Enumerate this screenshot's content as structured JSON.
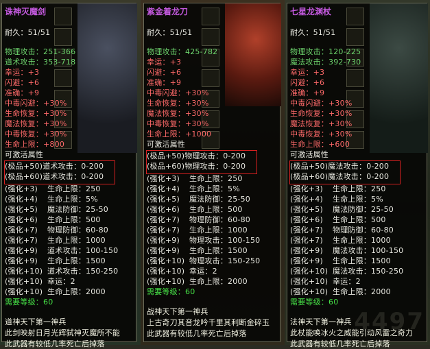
{
  "panels": [
    {
      "title": "诛神灭魔剑",
      "durability": {
        "label": "耐久：",
        "value": "51/51"
      },
      "base_stats": [
        {
          "label": "物理攻击：",
          "value": "251-366",
          "color": "green"
        },
        {
          "label": "道术攻击：",
          "value": "353-718",
          "color": "green"
        },
        {
          "label": "幸运：",
          "value": "+3",
          "color": "pink"
        },
        {
          "label": "闪避：",
          "value": "+6",
          "color": "pink"
        },
        {
          "label": "准确：",
          "value": "+9",
          "color": "pink"
        },
        {
          "label": "中毒闪避：",
          "value": "+30%",
          "color": "pink"
        },
        {
          "label": "生命恢复：",
          "value": "+30%",
          "color": "pink"
        },
        {
          "label": "魔法恢复：",
          "value": "+30%",
          "color": "pink"
        },
        {
          "label": "中毒恢复：",
          "value": "+30%",
          "color": "pink"
        },
        {
          "label": "生命上限：",
          "value": "+800",
          "color": "pink"
        }
      ],
      "activatable_label": "可激活属性",
      "highlighted": [
        {
          "tag": "(极品+50)",
          "label": "道术攻击：",
          "value": "0-200"
        },
        {
          "tag": "(极品+60)",
          "label": "道术攻击：",
          "value": "0-200"
        }
      ],
      "enhancements": [
        {
          "tag": "(强化+3)",
          "label": "生命上限：",
          "value": "250"
        },
        {
          "tag": "(强化+4)",
          "label": "生命上限：",
          "value": "5%"
        },
        {
          "tag": "(强化+5)",
          "label": "魔法防御：",
          "value": "25-50"
        },
        {
          "tag": "(强化+6)",
          "label": "生命上限：",
          "value": "500"
        },
        {
          "tag": "(强化+7)",
          "label": "物理防御：",
          "value": "60-80"
        },
        {
          "tag": "(强化+7)",
          "label": "生命上限：",
          "value": "1000"
        },
        {
          "tag": "(强化+9)",
          "label": "道术攻击：",
          "value": "100-150"
        },
        {
          "tag": "(强化+9)",
          "label": "生命上限：",
          "value": "1500"
        },
        {
          "tag": "(强化+10)",
          "label": "道术攻击：",
          "value": "150-250"
        },
        {
          "tag": "(强化+10)",
          "label": "幸运：",
          "value": "2"
        },
        {
          "tag": "(强化+10)",
          "label": "生命上限：",
          "value": "2000"
        }
      ],
      "requirement": {
        "label": "需要等级：",
        "value": "60"
      },
      "flavor": [
        "道神天下第一神兵",
        "此剑映射日月光辉弑神灭魔所不能",
        "此武器有较低几率死亡后掉落"
      ]
    },
    {
      "title": "紫金着龙刀",
      "durability": {
        "label": "耐久：",
        "value": "51/51"
      },
      "base_stats": [
        {
          "label": "物理攻击：",
          "value": "425-782",
          "color": "green"
        },
        {
          "label": "幸运：",
          "value": "+3",
          "color": "pink"
        },
        {
          "label": "闪避：",
          "value": "+6",
          "color": "pink"
        },
        {
          "label": "准确：",
          "value": "+9",
          "color": "pink"
        },
        {
          "label": "中毒闪避：",
          "value": "+30%",
          "color": "pink"
        },
        {
          "label": "生命恢复：",
          "value": "+30%",
          "color": "pink"
        },
        {
          "label": "魔法恢复：",
          "value": "+30%",
          "color": "pink"
        },
        {
          "label": "中毒恢复：",
          "value": "+30%",
          "color": "pink"
        },
        {
          "label": "生命上限：",
          "value": "+1000",
          "color": "pink"
        }
      ],
      "activatable_label": "可激活属性",
      "highlighted": [
        {
          "tag": "(极品+50)",
          "label": "物理攻击：",
          "value": "0-200"
        },
        {
          "tag": "(极品+60)",
          "label": "物理攻击：",
          "value": "0-200"
        }
      ],
      "enhancements": [
        {
          "tag": "(强化+3)",
          "label": "生命上限：",
          "value": "250"
        },
        {
          "tag": "(强化+4)",
          "label": "生命上限：",
          "value": "5%"
        },
        {
          "tag": "(强化+5)",
          "label": "魔法防御：",
          "value": "25-50"
        },
        {
          "tag": "(强化+6)",
          "label": "生命上限：",
          "value": "500"
        },
        {
          "tag": "(强化+7)",
          "label": "物理防御：",
          "value": "60-80"
        },
        {
          "tag": "(强化+7)",
          "label": "生命上限：",
          "value": "1000"
        },
        {
          "tag": "(强化+9)",
          "label": "物理攻击：",
          "value": "100-150"
        },
        {
          "tag": "(强化+9)",
          "label": "生命上限：",
          "value": "1500"
        },
        {
          "tag": "(强化+10)",
          "label": "物理攻击：",
          "value": "150-250"
        },
        {
          "tag": "(强化+10)",
          "label": "幸运：",
          "value": "2"
        },
        {
          "tag": "(强化+10)",
          "label": "生命上限：",
          "value": "2000"
        }
      ],
      "requirement": {
        "label": "需要等级：",
        "value": "60"
      },
      "flavor": [
        "战神天下第一神兵",
        "上古奇刀其音龙吟千里其利断金碎玉",
        "此武器有较低几率死亡后掉落"
      ]
    },
    {
      "title": "七星龙渊杖",
      "durability": {
        "label": "耐久：",
        "value": "51/51"
      },
      "base_stats": [
        {
          "label": "物理攻击：",
          "value": "120-225",
          "color": "green"
        },
        {
          "label": "魔法攻击：",
          "value": "392-730",
          "color": "green"
        },
        {
          "label": "幸运：",
          "value": "+3",
          "color": "pink"
        },
        {
          "label": "闪避：",
          "value": "+6",
          "color": "pink"
        },
        {
          "label": "准确：",
          "value": "+9",
          "color": "pink"
        },
        {
          "label": "中毒闪避：",
          "value": "+30%",
          "color": "pink"
        },
        {
          "label": "生命恢复：",
          "value": "+30%",
          "color": "pink"
        },
        {
          "label": "魔法恢复：",
          "value": "+30%",
          "color": "pink"
        },
        {
          "label": "中毒恢复：",
          "value": "+30%",
          "color": "pink"
        },
        {
          "label": "生命上限：",
          "value": "+600",
          "color": "pink"
        }
      ],
      "activatable_label": "可激活属性",
      "highlighted": [
        {
          "tag": "(极品+50)",
          "label": "魔法攻击：",
          "value": "0-200"
        },
        {
          "tag": "(极品+60)",
          "label": "魔法攻击：",
          "value": "0-200"
        }
      ],
      "enhancements": [
        {
          "tag": "(强化+3)",
          "label": "生命上限：",
          "value": "250"
        },
        {
          "tag": "(强化+4)",
          "label": "生命上限：",
          "value": "5%"
        },
        {
          "tag": "(强化+5)",
          "label": "魔法防御：",
          "value": "25-50"
        },
        {
          "tag": "(强化+6)",
          "label": "生命上限：",
          "value": "500"
        },
        {
          "tag": "(强化+7)",
          "label": "物理防御：",
          "value": "60-80"
        },
        {
          "tag": "(强化+7)",
          "label": "生命上限：",
          "value": "1000"
        },
        {
          "tag": "(强化+9)",
          "label": "魔法攻击：",
          "value": "100-150"
        },
        {
          "tag": "(强化+9)",
          "label": "生命上限：",
          "value": "1500"
        },
        {
          "tag": "(强化+10)",
          "label": "魔法攻击：",
          "value": "150-250"
        },
        {
          "tag": "(强化+10)",
          "label": "幸运：",
          "value": "2"
        },
        {
          "tag": "(强化+10)",
          "label": "生命上限：",
          "value": "2000"
        }
      ],
      "requirement": {
        "label": "需要等级：",
        "value": "60"
      },
      "flavor": [
        "法神天下第一神兵",
        "此杖能唤冰火之威能引动风雷之奇力",
        "此武器有较低几率死亡后掉落"
      ]
    }
  ],
  "watermark": "4497",
  "colors": {
    "title": "#c55ae0",
    "base_attack": "#6dd46d",
    "bonus": "#ff6a6a",
    "body": "#e8e8e0",
    "highlight_border": "#d62020",
    "requirement_value": "#46e046"
  }
}
